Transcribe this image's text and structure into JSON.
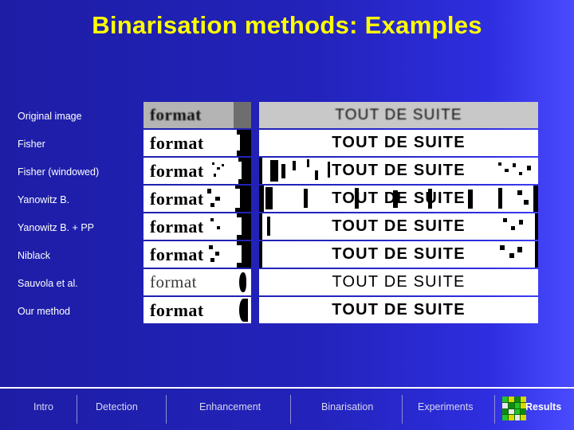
{
  "slide": {
    "title": "Binarisation methods: Examples",
    "title_color": "#ffff00",
    "background_color": "#2222b8"
  },
  "rows": [
    {
      "label": "Original image",
      "small_text": "format",
      "big_text": "TOUT DE SUITE"
    },
    {
      "label": "Fisher",
      "small_text": "format",
      "big_text": "TOUT DE SUITE"
    },
    {
      "label": "Fisher (windowed)",
      "small_text": "format",
      "big_text": "TOUT DE SUITE"
    },
    {
      "label": "Yanowitz B.",
      "small_text": "format",
      "big_text": "TOUT DE SUITE"
    },
    {
      "label": "Yanowitz B.  + PP",
      "small_text": "format",
      "big_text": "TOUT DE SUITE"
    },
    {
      "label": "Niblack",
      "small_text": "format",
      "big_text": "TOUT DE SUITE"
    },
    {
      "label": "Sauvola et al.",
      "small_text": "format",
      "big_text": "TOUT DE SUITE"
    },
    {
      "label": "Our method",
      "small_text": "format",
      "big_text": "TOUT DE SUITE"
    }
  ],
  "navbar": {
    "items": [
      {
        "label": "Intro",
        "active": false
      },
      {
        "label": "Detection",
        "active": false
      },
      {
        "label": "Enhancement",
        "active": false
      },
      {
        "label": "Binarisation",
        "active": false
      },
      {
        "label": "Experiments",
        "active": false
      },
      {
        "label": "Results",
        "active": true
      }
    ],
    "logo_name": "company-logo-icon"
  }
}
